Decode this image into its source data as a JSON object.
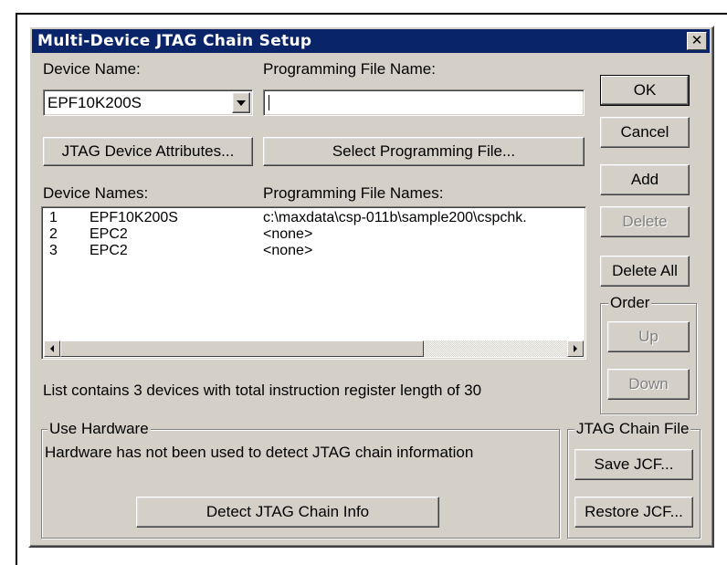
{
  "window": {
    "title": "Multi-Device JTAG Chain Setup",
    "close_glyph": "✕"
  },
  "labels": {
    "device_name": "Device Name:",
    "programming_file_name": "Programming File Name:",
    "device_names": "Device Names:",
    "programming_file_names": "Programming File Names:"
  },
  "device_select": {
    "value": "EPF10K200S"
  },
  "file_input": {
    "value": ""
  },
  "buttons": {
    "jtag_attributes": "JTAG Device Attributes...",
    "select_file": "Select Programming File...",
    "ok": "OK",
    "cancel": "Cancel",
    "add": "Add",
    "delete": "Delete",
    "delete_all": "Delete All",
    "up": "Up",
    "down": "Down",
    "detect": "Detect JTAG Chain Info",
    "save_jcf": "Save JCF...",
    "restore_jcf": "Restore JCF..."
  },
  "device_list": {
    "rows": [
      {
        "index": "1",
        "device": "EPF10K200S",
        "file": "c:\\maxdata\\csp-011b\\sample200\\cspchk."
      },
      {
        "index": "2",
        "device": "EPC2",
        "file": "<none>"
      },
      {
        "index": "3",
        "device": "EPC2",
        "file": "<none>"
      }
    ]
  },
  "status_text": "List contains 3 devices with total instruction register length of 30",
  "groups": {
    "order": "Order",
    "use_hardware": "Use Hardware",
    "hardware_msg": "Hardware has not been used to detect JTAG chain information",
    "jtag_chain_file": "JTAG Chain File"
  }
}
